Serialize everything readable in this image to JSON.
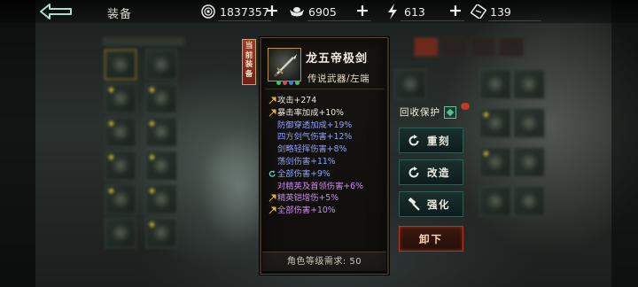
{
  "topbar": {
    "title": "装备",
    "resources": [
      {
        "icon": "coin-icon",
        "value": "1837357"
      },
      {
        "icon": "ingot-icon",
        "value": "6905"
      },
      {
        "icon": "stamina-lightning-icon",
        "value": "613"
      },
      {
        "icon": "ticket-icon",
        "value": "139"
      }
    ]
  },
  "item": {
    "equipped_label": [
      "当",
      "前",
      "装",
      "备"
    ],
    "name": "龙五帝极剑",
    "subtitle": "传说武器/左端",
    "gem_colors": [
      "#3fc36b",
      "#e04848",
      "#3f7ee0",
      "#3fc36b"
    ],
    "stats": [
      {
        "icon": "gold-arrow",
        "text": "攻击+274",
        "color": "white"
      },
      {
        "icon": "gold-arrow",
        "text": "暴击率加成+10%",
        "color": "white"
      },
      {
        "icon": "",
        "text": "防御穿透加成+19%",
        "color": "blue"
      },
      {
        "icon": "",
        "text": "四方剑气伤害+12%",
        "color": "blue"
      },
      {
        "icon": "",
        "text": "剑略轻挥伤害+8%",
        "color": "blue"
      },
      {
        "icon": "",
        "text": "荡剑伤害+11%",
        "color": "blue"
      },
      {
        "icon": "reroll-arrow",
        "text": "全部伤害+9%",
        "color": "blue"
      },
      {
        "icon": "",
        "text": "对精英及首领伤害+6%",
        "color": "purple"
      },
      {
        "icon": "gold-arrow",
        "text": "精英铠增伤+5%",
        "color": "purple"
      },
      {
        "icon": "gold-arrow",
        "text": "全部伤害+10%",
        "color": "purple"
      }
    ],
    "requirement": "角色等级需求: 50"
  },
  "actions": {
    "protect_label": "回收保护",
    "reforge": "重刻",
    "modify": "改造",
    "strengthen": "强化",
    "unequip": "卸下"
  },
  "colors": {
    "accent_gold": "#c79b2e",
    "teal_button": "#2f5d56",
    "unequip_red": "#b23a1c"
  }
}
